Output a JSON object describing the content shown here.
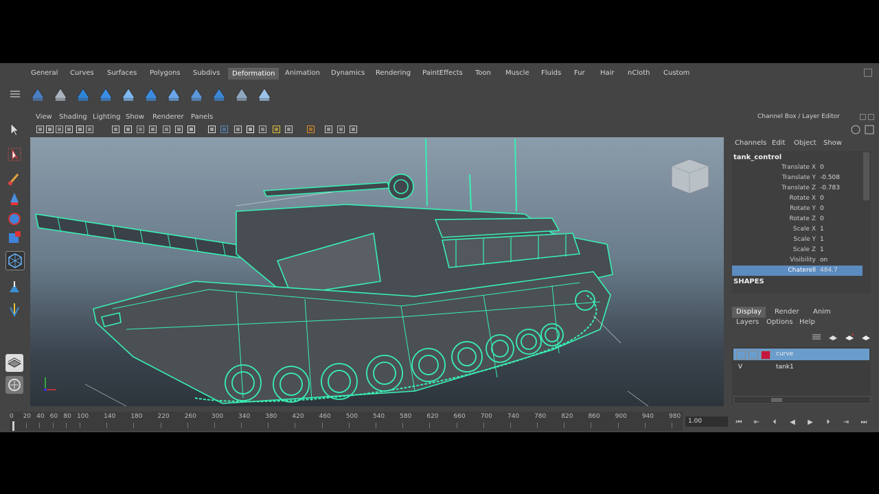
{
  "shelf_tabs": [
    {
      "label": "General"
    },
    {
      "label": "Curves"
    },
    {
      "label": "Surfaces"
    },
    {
      "label": "Polygons"
    },
    {
      "label": "Subdivs"
    },
    {
      "label": "Deformation",
      "active": true
    },
    {
      "label": "Animation"
    },
    {
      "label": "Dynamics"
    },
    {
      "label": "Rendering"
    },
    {
      "label": "PaintEffects"
    },
    {
      "label": "Toon"
    },
    {
      "label": "Muscle"
    },
    {
      "label": "Fluids"
    },
    {
      "label": "Fur"
    },
    {
      "label": "Hair"
    },
    {
      "label": "nCloth"
    },
    {
      "label": "Custom"
    }
  ],
  "shelf_icons": [
    "lattice-icon",
    "cluster-icon",
    "bend-icon",
    "nonlinear-icon",
    "sculpt-icon",
    "wrap-icon",
    "wire-icon",
    "blendshape-icon",
    "wave-icon",
    "twist-icon",
    "softmod-icon"
  ],
  "panel_menu": [
    "View",
    "Shading",
    "Lighting",
    "Show",
    "Renderer",
    "Panels"
  ],
  "channel_box": {
    "title": "Channel Box / Layer Editor",
    "menu": [
      "Channels",
      "Edit",
      "Object",
      "Show"
    ],
    "object_name": "tank_control",
    "attributes": [
      {
        "label": "Translate X",
        "value": "0"
      },
      {
        "label": "Translate Y",
        "value": "-0.508"
      },
      {
        "label": "Translate Z",
        "value": "-0.783"
      },
      {
        "label": "Rotate X",
        "value": "0"
      },
      {
        "label": "Rotate Y",
        "value": "0"
      },
      {
        "label": "Rotate Z",
        "value": "0"
      },
      {
        "label": "Scale X",
        "value": "1"
      },
      {
        "label": "Scale Y",
        "value": "1"
      },
      {
        "label": "Scale Z",
        "value": "1"
      },
      {
        "label": "Visibility",
        "value": "on"
      },
      {
        "label": "Chaterell",
        "value": "484.7",
        "selected": true
      }
    ],
    "shapes_label": "SHAPES"
  },
  "layer_editor": {
    "tabs": [
      {
        "label": "Display",
        "active": true
      },
      {
        "label": "Render"
      },
      {
        "label": "Anim"
      }
    ],
    "menu": [
      "Layers",
      "Options",
      "Help"
    ],
    "layers": [
      {
        "name": "curve",
        "visible": "",
        "selected": true,
        "color": "#c4163e"
      },
      {
        "name": "tank1",
        "visible": "V",
        "selected": false,
        "color": ""
      }
    ]
  },
  "timeline": {
    "ticks": [
      "0",
      "20",
      "40",
      "60",
      "80",
      "100",
      "140",
      "180",
      "220",
      "260",
      "300",
      "340",
      "380",
      "420",
      "460",
      "500",
      "540",
      "580",
      "620",
      "660",
      "700",
      "740",
      "780",
      "820",
      "860",
      "900",
      "940",
      "980"
    ],
    "current_time": "1.00"
  },
  "colors": {
    "wireframe": "#39f0b4",
    "panel": "#444444",
    "selection": "#5b8bbf",
    "layer_swatch": "#c4163e"
  }
}
